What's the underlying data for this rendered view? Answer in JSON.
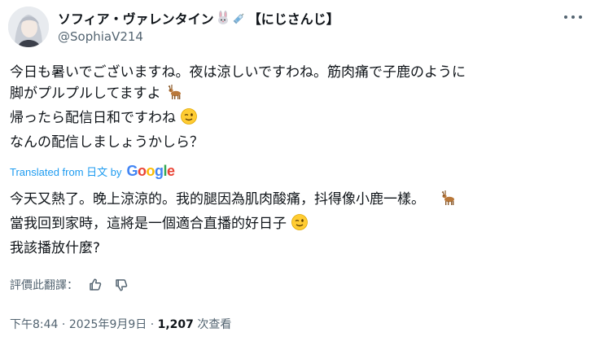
{
  "author": {
    "display_name": "ソフィア・ヴァレンタイン",
    "name_suffix": "【にじさんじ】",
    "handle": "@SophiaV214",
    "name_emojis": [
      "rabbit-icon",
      "syringe-icon"
    ]
  },
  "tweet": {
    "original_lines": [
      "今日も暑いでございますね。夜は涼しいですわね。筋肉痛で子鹿のように",
      "脚がプルプルしてますよ",
      "帰ったら配信日和ですわね",
      "なんの配信しましょうかしら？"
    ],
    "translated_from_label": "Translated from 日文 by",
    "google_label": "Google",
    "translation_lines": [
      "今天又熱了。晚上涼涼的。我的腿因為肌肉酸痛，抖得像小鹿一樣。",
      "當我回到家時，這將是一個適合直播的好日子",
      "我該播放什麼?"
    ]
  },
  "rating": {
    "label": "評價此翻譯："
  },
  "meta": {
    "time": "下午8:44",
    "sep1": " · ",
    "date": "2025年9月9日",
    "sep2": " · ",
    "views": "1,207",
    "views_label": " 次查看"
  },
  "colors": {
    "text": "#0f1419",
    "secondary": "#536471",
    "link": "#1d9bf0"
  }
}
